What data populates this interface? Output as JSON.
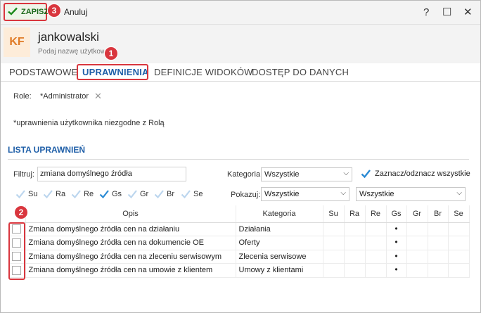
{
  "toolbar": {
    "save_label": "ZAPISZ",
    "cancel_label": "Anuluj",
    "help_glyph": "?",
    "maximize_glyph": "☐",
    "close_glyph": "✕"
  },
  "badges": {
    "b1": "1",
    "b2": "2",
    "b3": "3"
  },
  "header": {
    "initials": "KF",
    "name": "jankowalski",
    "subtitle": "Podaj nazwę użytkow"
  },
  "tabs": [
    {
      "label": "PODSTAWOWE"
    },
    {
      "label": "UPRAWNIENIA"
    },
    {
      "label": "DEFINICJE WIDOKÓW"
    },
    {
      "label": "DOSTĘP DO DANYCH"
    }
  ],
  "role": {
    "label": "Role:",
    "value": "*Administrator",
    "remove_glyph": "✕"
  },
  "note": "*uprawnienia użytkownika niezgodne z Rolą",
  "section_title": "LISTA UPRAWNIEŃ",
  "filters": {
    "filter_label": "Filtruj:",
    "filter_value": "zmiana domyślnego źródła",
    "category_label": "Kategoria:",
    "category_value": "Wszystkie",
    "checkall_label": "Zaznacz/odznacz wszystkie",
    "show_label": "Pokazuj:",
    "show_value": "Wszystkie",
    "extra_value": "Wszystkie"
  },
  "perm_toggles": [
    {
      "label": "Su",
      "checked": false
    },
    {
      "label": "Ra",
      "checked": false
    },
    {
      "label": "Re",
      "checked": false
    },
    {
      "label": "Gs",
      "checked": true
    },
    {
      "label": "Gr",
      "checked": false
    },
    {
      "label": "Br",
      "checked": false
    },
    {
      "label": "Se",
      "checked": false
    }
  ],
  "table": {
    "headers": [
      "",
      "Opis",
      "Kategoria",
      "Su",
      "Ra",
      "Re",
      "Gs",
      "Gr",
      "Br",
      "Se"
    ],
    "dot_glyph": "•",
    "rows": [
      {
        "opis": "Zmiana domyślnego źródła cen na działaniu",
        "kategoria": "Działania"
      },
      {
        "opis": "Zmiana domyślnego źródła cen na dokumencie OE",
        "kategoria": "Oferty"
      },
      {
        "opis": "Zmiana domyślnego źródła cen na zleceniu serwisowym",
        "kategoria": "Zlecenia serwisowe"
      },
      {
        "opis": "Zmiana domyślnego źródła cen na umowie z klientem",
        "kategoria": "Umowy z klientami"
      }
    ]
  },
  "colors": {
    "accent": "#1f5fa8",
    "highlight": "#d9363e",
    "save_green": "#1c6a1c",
    "check_blue": "#2a8ad4",
    "check_faint": "#bcd6ee"
  }
}
